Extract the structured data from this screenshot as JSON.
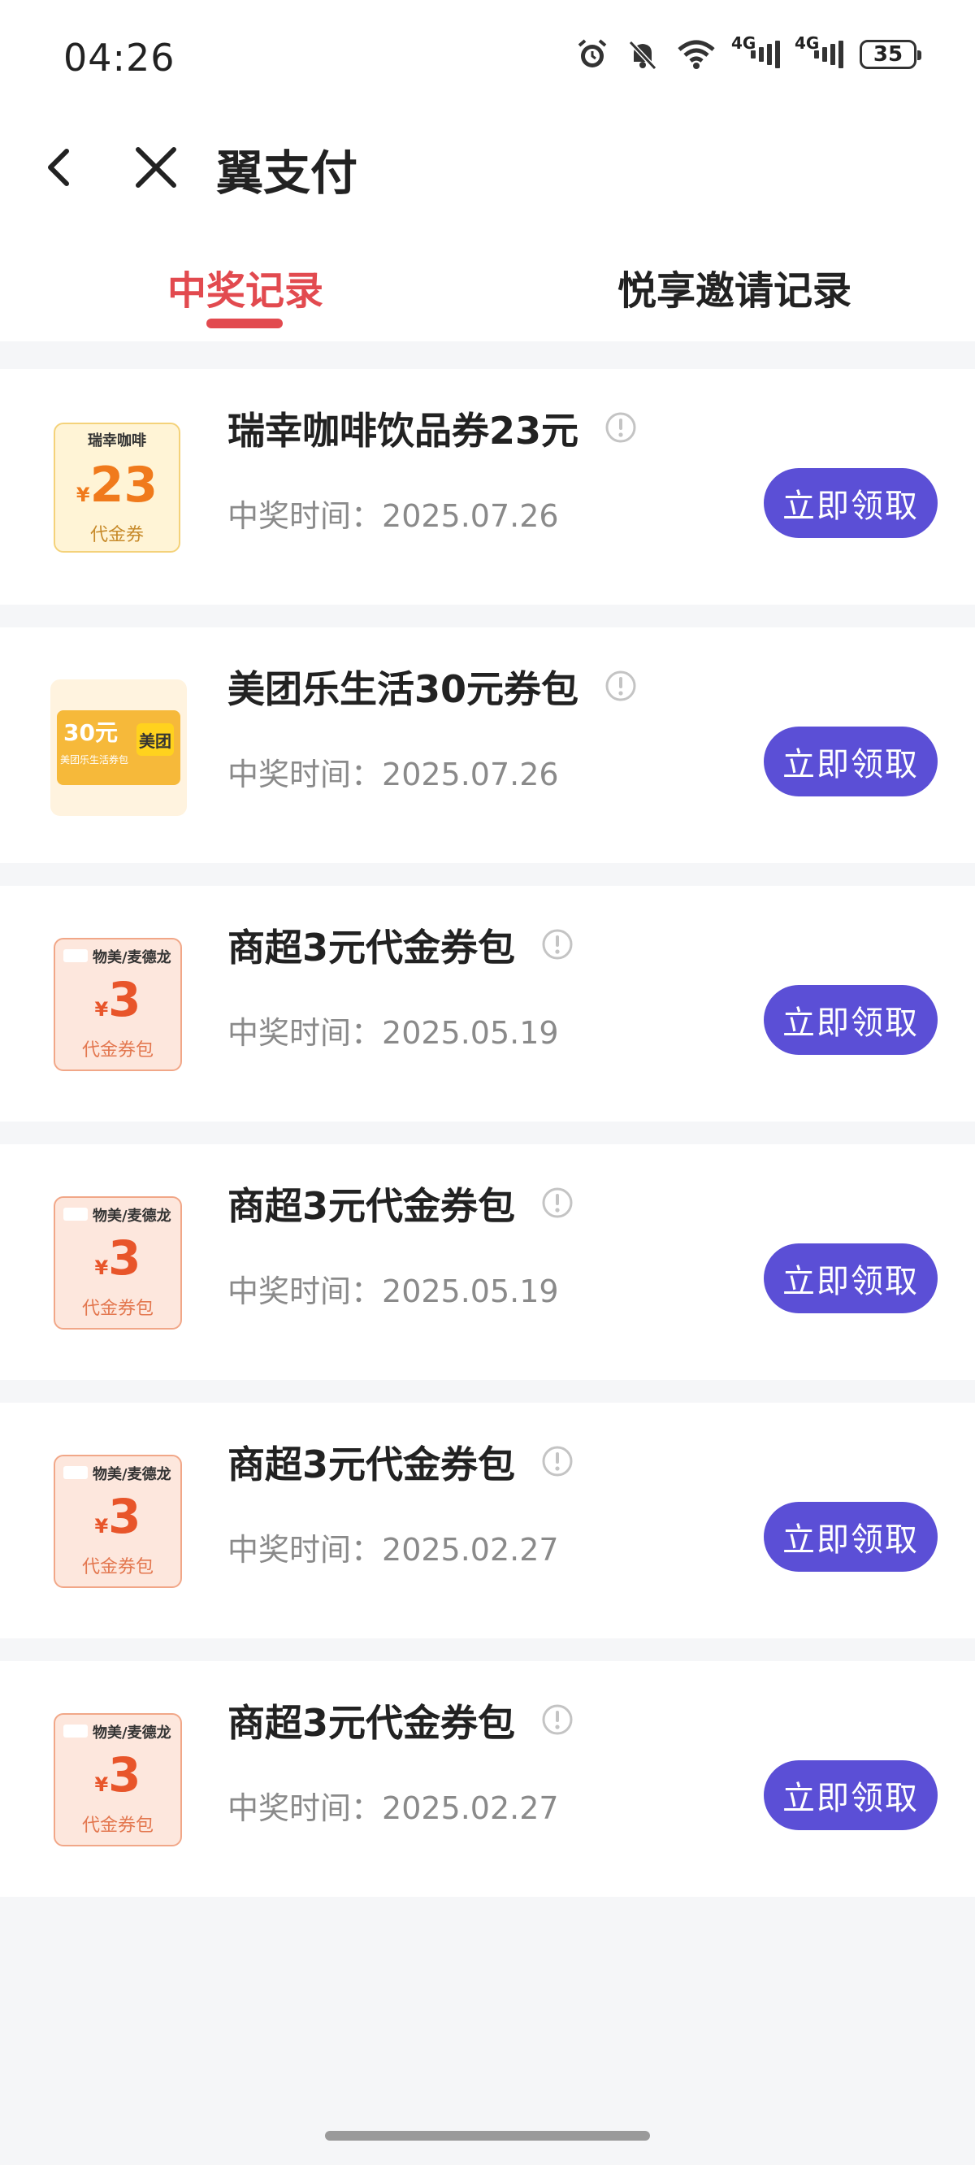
{
  "status_bar": {
    "time": "04:26",
    "network_label": "4G",
    "battery": "35"
  },
  "nav": {
    "title": "翼支付"
  },
  "tabs": [
    {
      "label": "中奖记录",
      "active": true
    },
    {
      "label": "悦享邀请记录",
      "active": false
    }
  ],
  "time_label": "中奖时间：",
  "claim_label": "立即领取",
  "items": [
    {
      "title": "瑞幸咖啡饮品券23元",
      "date": "2025.07.26",
      "thumb": {
        "brand": "瑞幸咖啡",
        "currency": "¥",
        "amount": "23",
        "label": "代金券"
      }
    },
    {
      "title": "美团乐生活30元券包",
      "date": "2025.07.26",
      "thumb": {
        "amount": "30元",
        "sub": "美团乐生活券包",
        "logo": "美团"
      }
    },
    {
      "title": "商超3元代金券包",
      "date": "2025.05.19",
      "thumb": {
        "brand": "物美/麦德龙",
        "currency": "¥",
        "amount": "3",
        "label": "代金券包"
      }
    },
    {
      "title": "商超3元代金券包",
      "date": "2025.05.19",
      "thumb": {
        "brand": "物美/麦德龙",
        "currency": "¥",
        "amount": "3",
        "label": "代金券包"
      }
    },
    {
      "title": "商超3元代金券包",
      "date": "2025.02.27",
      "thumb": {
        "brand": "物美/麦德龙",
        "currency": "¥",
        "amount": "3",
        "label": "代金券包"
      }
    },
    {
      "title": "商超3元代金券包",
      "date": "2025.02.27",
      "thumb": {
        "brand": "物美/麦德龙",
        "currency": "¥",
        "amount": "3",
        "label": "代金券包"
      }
    }
  ],
  "colors": {
    "accent": "#e24a4f",
    "button": "#5b4fd6"
  },
  "icons": [
    "back-arrow-icon",
    "close-icon",
    "info-icon",
    "alarm-icon",
    "bell-off-icon",
    "wifi-icon"
  ]
}
